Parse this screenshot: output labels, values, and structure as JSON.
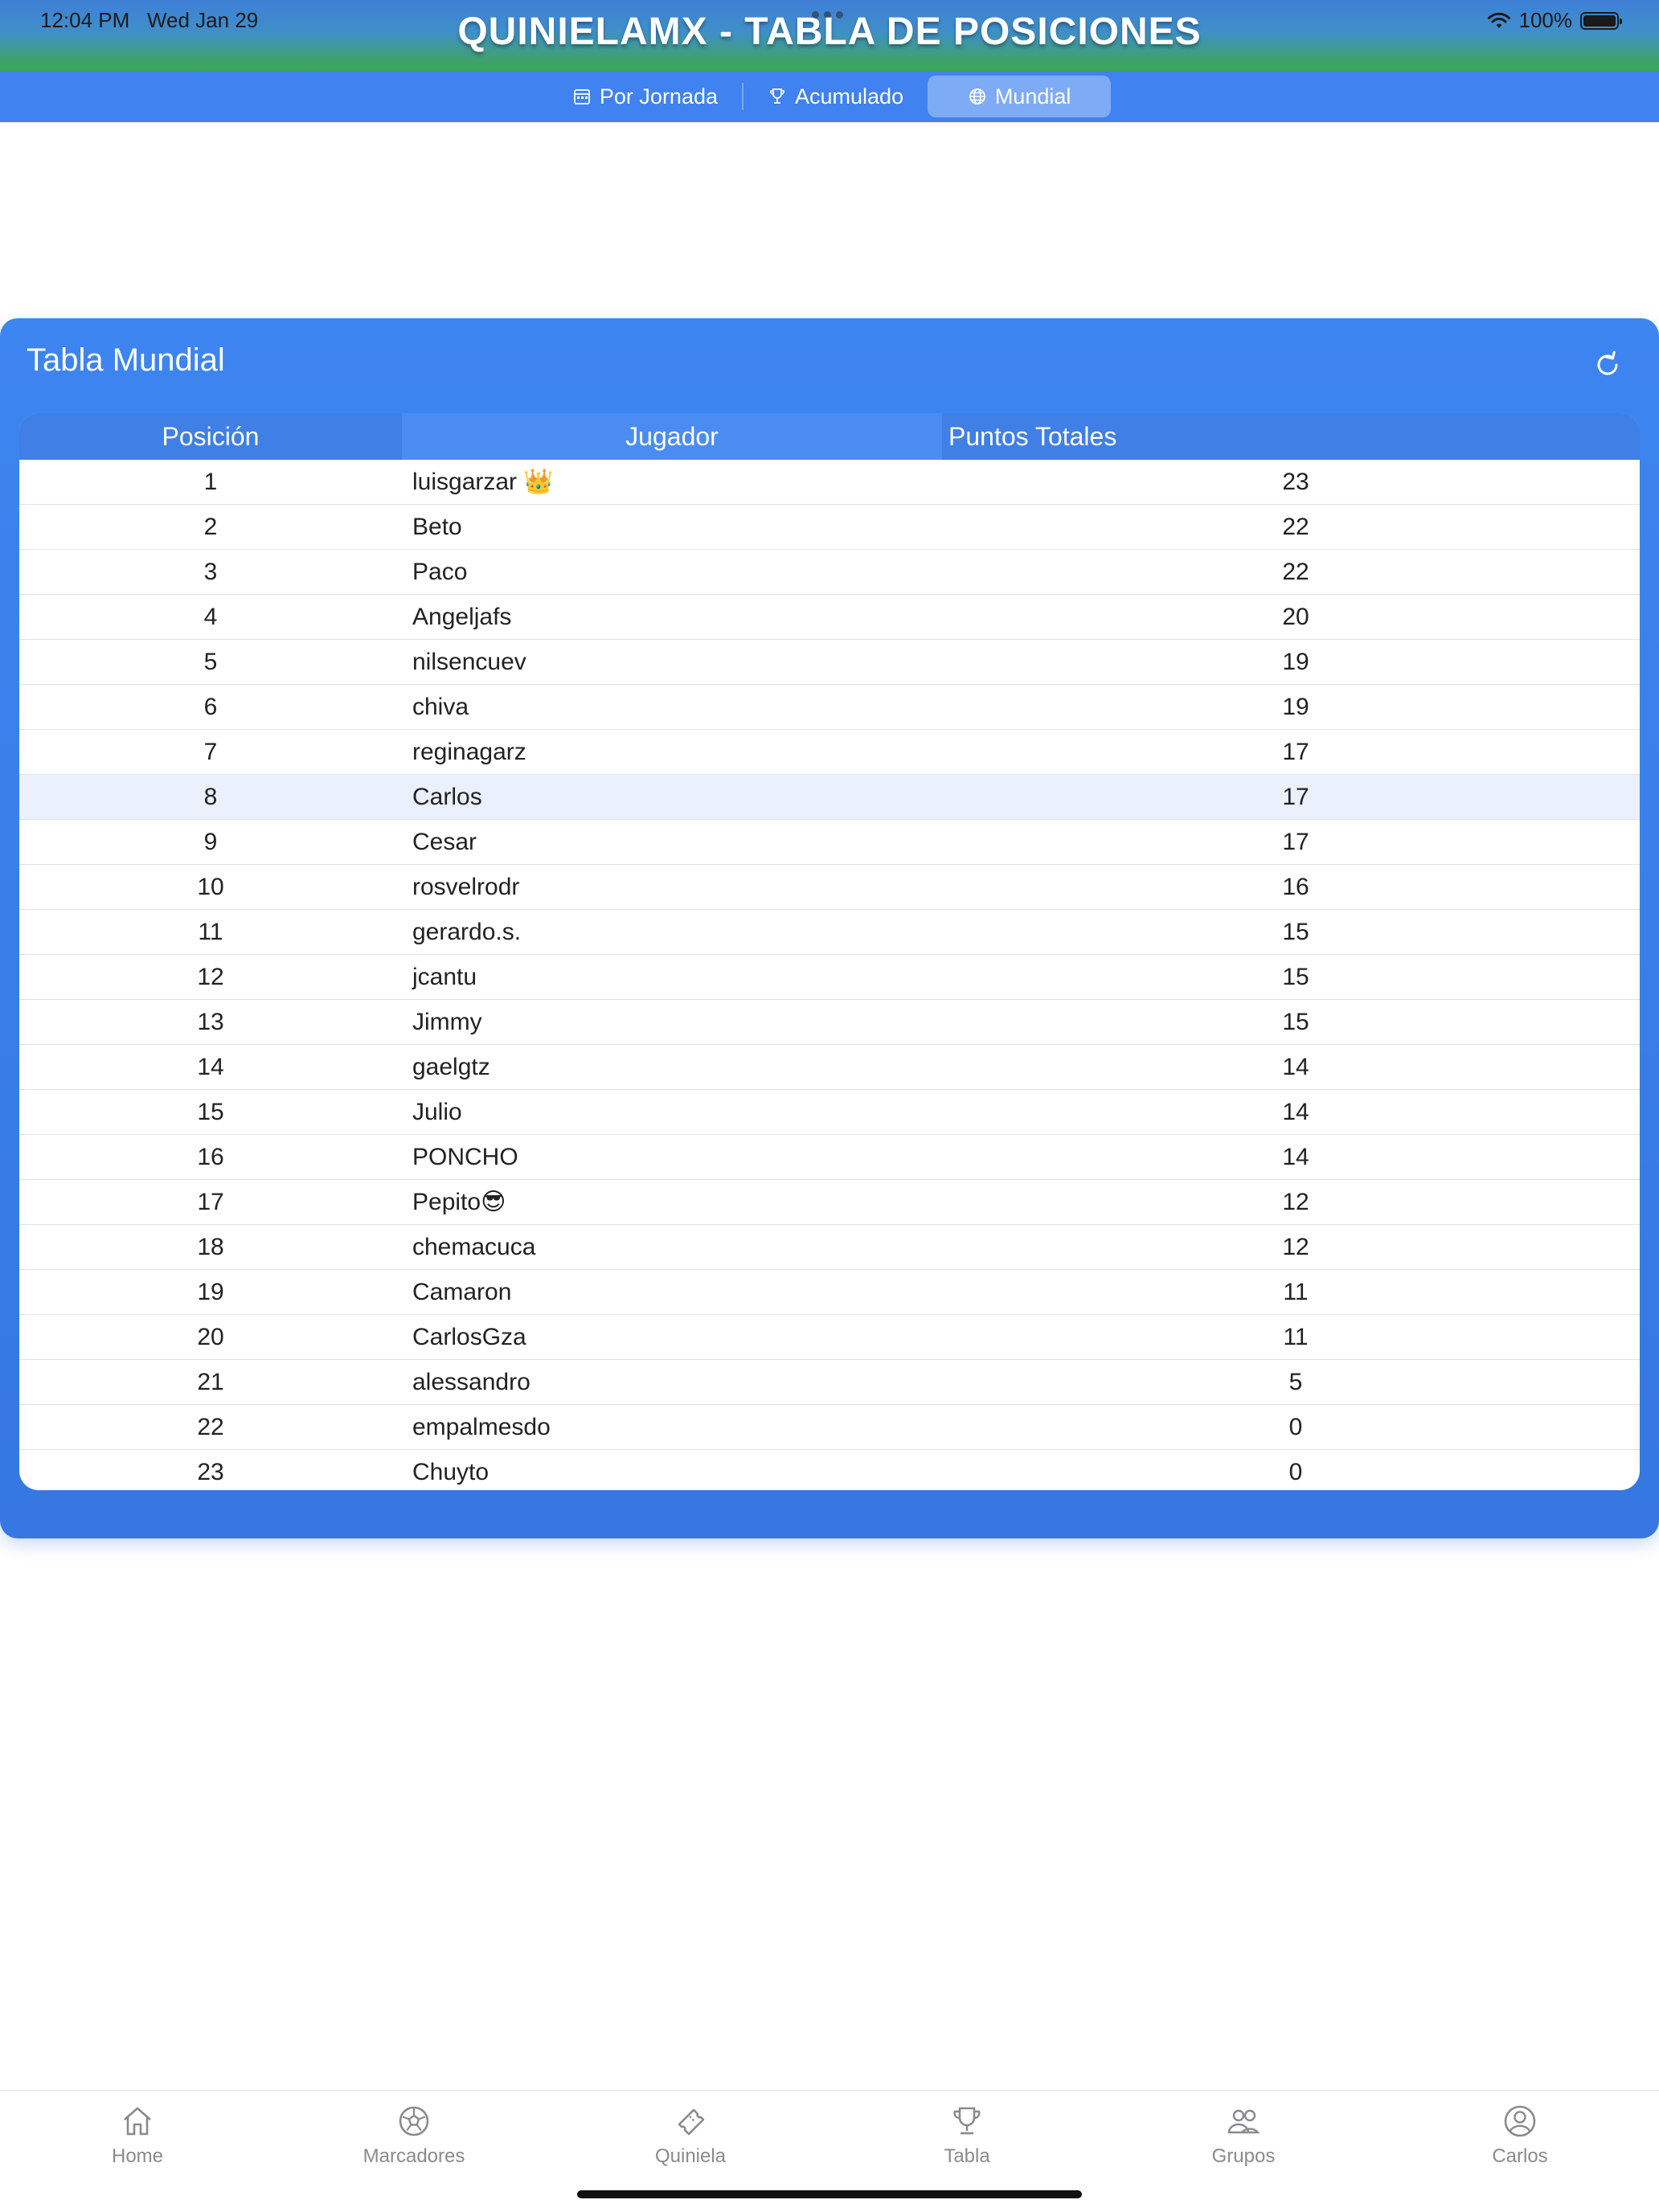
{
  "status": {
    "time": "12:04 PM",
    "date": "Wed Jan 29",
    "battery": "100%"
  },
  "header": {
    "title": "QUINIELAMX  -  TABLA DE POSICIONES"
  },
  "tabs": [
    {
      "label": "Por Jornada",
      "icon": "calendar-icon",
      "active": false
    },
    {
      "label": "Acumulado",
      "icon": "trophy-icon",
      "active": false
    },
    {
      "label": "Mundial",
      "icon": "globe-icon",
      "active": true
    }
  ],
  "card": {
    "title": "Tabla Mundial",
    "refresh_icon": "refresh-icon"
  },
  "table": {
    "columns": [
      "Posición",
      "Jugador",
      "Puntos Totales"
    ],
    "rows": [
      {
        "pos": "1",
        "player": "luisgarzar 👑",
        "pts": "23"
      },
      {
        "pos": "2",
        "player": "Beto",
        "pts": "22"
      },
      {
        "pos": "3",
        "player": "Paco",
        "pts": "22"
      },
      {
        "pos": "4",
        "player": "Angeljafs",
        "pts": "20"
      },
      {
        "pos": "5",
        "player": "nilsencuev",
        "pts": "19"
      },
      {
        "pos": "6",
        "player": "chiva",
        "pts": "19"
      },
      {
        "pos": "7",
        "player": "reginagarz",
        "pts": "17"
      },
      {
        "pos": "8",
        "player": "Carlos",
        "pts": "17",
        "highlighted": true
      },
      {
        "pos": "9",
        "player": "Cesar",
        "pts": "17"
      },
      {
        "pos": "10",
        "player": "rosvelrodr",
        "pts": "16"
      },
      {
        "pos": "11",
        "player": "gerardo.s.",
        "pts": "15"
      },
      {
        "pos": "12",
        "player": "jcantu",
        "pts": "15"
      },
      {
        "pos": "13",
        "player": "Jimmy",
        "pts": "15"
      },
      {
        "pos": "14",
        "player": "gaelgtz",
        "pts": "14"
      },
      {
        "pos": "15",
        "player": "Julio",
        "pts": "14"
      },
      {
        "pos": "16",
        "player": "PONCHO",
        "pts": "14"
      },
      {
        "pos": "17",
        "player": "Pepito😎",
        "pts": "12"
      },
      {
        "pos": "18",
        "player": "chemacuca",
        "pts": "12"
      },
      {
        "pos": "19",
        "player": "Camaron",
        "pts": "11"
      },
      {
        "pos": "20",
        "player": "CarlosGza",
        "pts": "11"
      },
      {
        "pos": "21",
        "player": "alessandro",
        "pts": "5"
      },
      {
        "pos": "22",
        "player": "empalmesdo",
        "pts": "0"
      },
      {
        "pos": "23",
        "player": "Chuyto",
        "pts": "0"
      }
    ]
  },
  "bottom_nav": [
    {
      "label": "Home",
      "icon": "home-icon"
    },
    {
      "label": "Marcadores",
      "icon": "soccer-ball-icon"
    },
    {
      "label": "Quiniela",
      "icon": "ticket-icon"
    },
    {
      "label": "Tabla",
      "icon": "trophy-icon"
    },
    {
      "label": "Grupos",
      "icon": "group-icon"
    },
    {
      "label": "Carlos",
      "icon": "profile-icon"
    }
  ],
  "colors": {
    "accent": "#3f82f0",
    "card": "#3d85f0",
    "highlight_row": "#eaf1fc",
    "nav_gray": "#8a8a8e"
  }
}
